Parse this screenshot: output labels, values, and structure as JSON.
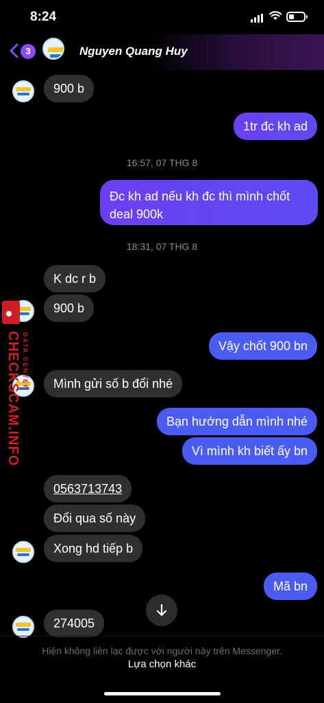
{
  "status": {
    "time": "8:24"
  },
  "header": {
    "unread_count": "3",
    "contact_name": "Nguyen Quang Huy"
  },
  "messages": [
    {
      "from": "them",
      "text": "900 b"
    },
    {
      "from": "me",
      "text": "1tr đc kh ad"
    },
    {
      "type": "timestamp",
      "text": "16:57, 07 THG 8"
    },
    {
      "from": "me",
      "text": "Đc kh ad nếu kh đc thì mình chốt deal 900k"
    },
    {
      "type": "timestamp",
      "text": "18:31, 07 THG 8"
    },
    {
      "from": "them",
      "text": "K dc r b"
    },
    {
      "from": "them",
      "text": "900 b"
    },
    {
      "from": "me",
      "text": "Vậy chốt 900 bn"
    },
    {
      "from": "them",
      "text": "Mình gửi số b đổi nhé"
    },
    {
      "from": "me",
      "text": "Bạn hướng dẫn mình nhé"
    },
    {
      "from": "me",
      "text": "Vì mình kh biết ấy bn"
    },
    {
      "from": "them",
      "text": "0563713743"
    },
    {
      "from": "them",
      "text": "Đổi qua số này"
    },
    {
      "from": "them",
      "text": "Xong hd tiếp b"
    },
    {
      "from": "me",
      "text": "Mã bn"
    },
    {
      "from": "them",
      "text": "274005"
    }
  ],
  "watermark": {
    "main": "CHECKSCAM.INFO",
    "sub": "DATA CENTER"
  },
  "footer": {
    "notice": "Hiện không liên lạc được với người này trên Messenger.",
    "options_label": "Lựa chọn khác"
  },
  "colors": {
    "outgoing": "#6b3ff0",
    "outgoing_blue": "#4a5cf2",
    "incoming": "#303030",
    "badge": "#8a4cf2"
  }
}
